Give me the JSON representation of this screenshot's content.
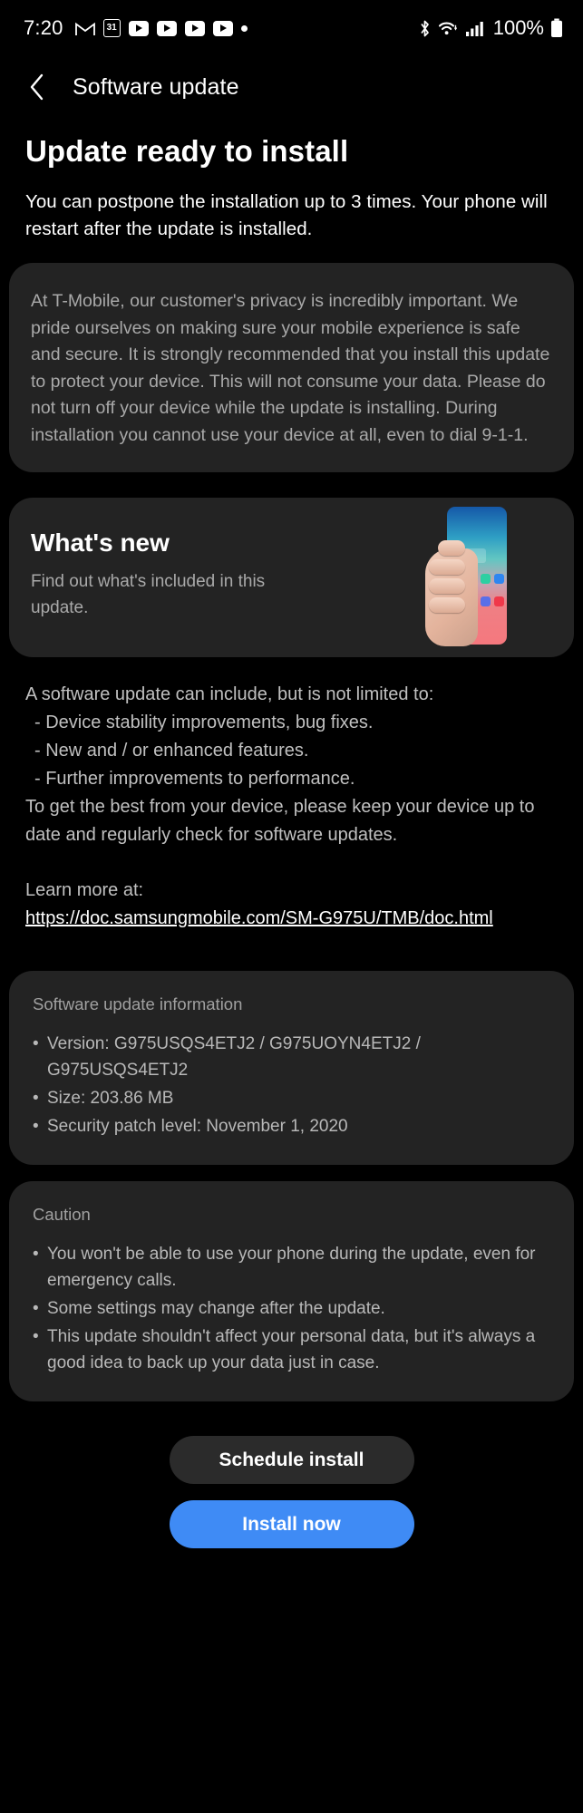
{
  "status_bar": {
    "time": "7:20",
    "left_icons": [
      {
        "name": "gmail-icon",
        "glyph": "M"
      },
      {
        "name": "calendar-icon",
        "glyph": "31"
      },
      {
        "name": "youtube-icon-1",
        "glyph": ""
      },
      {
        "name": "youtube-icon-2",
        "glyph": ""
      },
      {
        "name": "youtube-icon-3",
        "glyph": ""
      },
      {
        "name": "youtube-icon-4",
        "glyph": ""
      },
      {
        "name": "more-notifications-dot",
        "glyph": ""
      }
    ],
    "bluetooth_icon": "bluetooth-icon",
    "wifi_icon": "wifi-icon",
    "signal_icon": "cellular-signal-icon",
    "battery_percent": "100%",
    "battery_icon": "battery-full-icon"
  },
  "app_bar": {
    "back_icon": "back-chevron-icon",
    "title": "Software update"
  },
  "page": {
    "title": "Update ready to install",
    "subtitle": "You can postpone the installation up to 3 times. Your phone will restart after the update is installed."
  },
  "carrier_notice": {
    "text": "At T-Mobile, our customer's privacy is incredibly important. We pride ourselves on making sure your mobile experience is safe and secure. It is strongly recommended that you install this update to protect your device. This will not consume your data. Please do not turn off your device while the update is installing. During installation you cannot use your device at all, even to dial 9-1-1."
  },
  "whats_new": {
    "title": "What's new",
    "subtitle": "Find out what's included in this update.",
    "art_name": "hand-holding-phone-illustration",
    "phone_icon_colors_row1": [
      "#a259d8",
      "#f0465a",
      "#2ecfa2",
      "#2e86f0"
    ],
    "phone_icon_colors_row2": [
      "#2fbf5a",
      "#2e9ef0",
      "#5a6fe8",
      "#f0384a"
    ]
  },
  "update_body": {
    "intro": "A software update can include, but is not limited to:",
    "items": [
      "- Device stability improvements, bug fixes.",
      "- New and / or enhanced features.",
      "- Further improvements to performance."
    ],
    "outro": "To get the best from your device, please keep your device up to date and regularly check for software updates.",
    "learn_more_label": "Learn more at:",
    "learn_more_url": "https://doc.samsungmobile.com/SM-G975U/TMB/doc.html"
  },
  "software_info": {
    "heading": "Software update information",
    "items": [
      "Version: G975USQS4ETJ2 / G975UOYN4ETJ2 / G975USQS4ETJ2",
      "Size: 203.86 MB",
      "Security patch level: November 1, 2020"
    ]
  },
  "caution": {
    "heading": "Caution",
    "items": [
      "You won't be able to use your phone during the update, even for emergency calls.",
      "Some settings may change after the update.",
      "This update shouldn't affect your personal data, but it's always a good idea to back up your data just in case."
    ]
  },
  "actions": {
    "schedule_label": "Schedule install",
    "install_label": "Install now",
    "primary_color": "#3f8bf5",
    "secondary_color": "#2b2b2b"
  }
}
